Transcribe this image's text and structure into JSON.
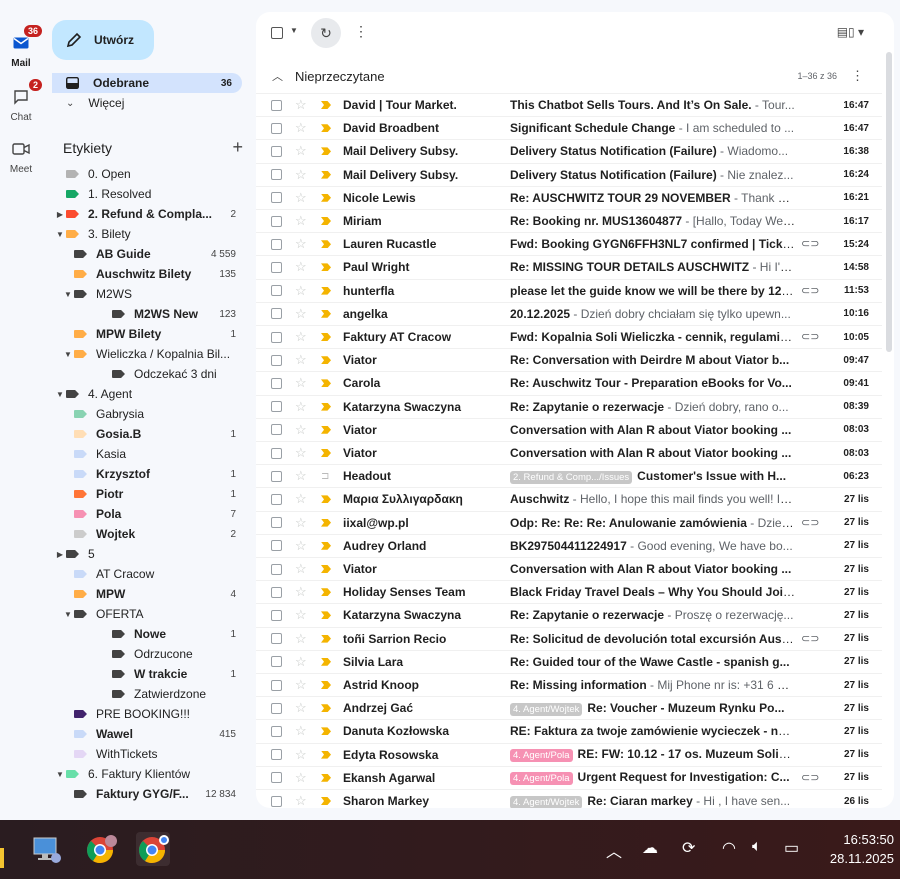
{
  "rail": [
    {
      "label": "Mail",
      "badge": "36",
      "active": true
    },
    {
      "label": "Chat",
      "badge": "2",
      "active": false
    },
    {
      "label": "Meet",
      "badge": null,
      "active": false
    }
  ],
  "sidebar": {
    "compose_label": "Utwórz",
    "nav": [
      {
        "label": "Odebrane",
        "count": "36"
      },
      {
        "label": "Więcej",
        "count": ""
      }
    ],
    "labels_title": "Etykiety",
    "labels": [
      {
        "name": "0. Open",
        "color": "#b3b3b3",
        "arrow": "",
        "indent": 0,
        "bold": false,
        "count": ""
      },
      {
        "name": "1. Resolved",
        "color": "#16a765",
        "arrow": "",
        "indent": 0,
        "bold": false,
        "count": ""
      },
      {
        "name": "2. Refund & Compla...",
        "color": "#fb4c2f",
        "arrow": "▶",
        "indent": 0,
        "bold": true,
        "count": "2"
      },
      {
        "name": "3. Bilety",
        "color": "#ffad47",
        "arrow": "▼",
        "indent": 0,
        "bold": false,
        "count": ""
      },
      {
        "name": "AB Guide",
        "color": "#434343",
        "arrow": "",
        "indent": 1,
        "bold": true,
        "count": "4 559"
      },
      {
        "name": "Auschwitz Bilety",
        "color": "#ffad47",
        "arrow": "",
        "indent": 1,
        "bold": true,
        "count": "135"
      },
      {
        "name": "M2WS",
        "color": "#434343",
        "arrow": "▼",
        "indent": 1,
        "bold": false,
        "count": ""
      },
      {
        "name": "M2WS New",
        "color": "#434343",
        "arrow": "",
        "indent": 2,
        "bold": true,
        "count": "123"
      },
      {
        "name": "MPW Bilety",
        "color": "#ffad47",
        "arrow": "",
        "indent": 1,
        "bold": true,
        "count": "1"
      },
      {
        "name": "Wieliczka / Kopalnia Bil...",
        "color": "#ffad47",
        "arrow": "▼",
        "indent": 1,
        "bold": false,
        "count": ""
      },
      {
        "name": "Odczekać 3 dni",
        "color": "#434343",
        "arrow": "",
        "indent": 2,
        "bold": false,
        "count": ""
      },
      {
        "name": "4. Agent",
        "color": "#434343",
        "arrow": "▼",
        "indent": 0,
        "bold": false,
        "count": ""
      },
      {
        "name": "Gabrysia",
        "color": "#89d3b2",
        "arrow": "",
        "indent": 1,
        "bold": false,
        "count": ""
      },
      {
        "name": "Gosia.B",
        "color": "#ffdeb5",
        "arrow": "",
        "indent": 1,
        "bold": true,
        "count": "1"
      },
      {
        "name": "Kasia",
        "color": "#c9daf8",
        "arrow": "",
        "indent": 1,
        "bold": false,
        "count": ""
      },
      {
        "name": "Krzysztof",
        "color": "#c9daf8",
        "arrow": "",
        "indent": 1,
        "bold": true,
        "count": "1"
      },
      {
        "name": "Piotr",
        "color": "#ff7537",
        "arrow": "",
        "indent": 1,
        "bold": true,
        "count": "1"
      },
      {
        "name": "Pola",
        "color": "#f691b3",
        "arrow": "",
        "indent": 1,
        "bold": true,
        "count": "7"
      },
      {
        "name": "Wojtek",
        "color": "#cccccc",
        "arrow": "",
        "indent": 1,
        "bold": true,
        "count": "2"
      },
      {
        "name": "5",
        "color": "#434343",
        "arrow": "▶",
        "indent": 0,
        "bold": false,
        "count": ""
      },
      {
        "name": "AT Cracow",
        "color": "#c9daf8",
        "arrow": "",
        "indent": 1,
        "bold": false,
        "count": ""
      },
      {
        "name": "MPW",
        "color": "#ffad47",
        "arrow": "",
        "indent": 1,
        "bold": true,
        "count": "4"
      },
      {
        "name": "OFERTA",
        "color": "#434343",
        "arrow": "▼",
        "indent": 1,
        "bold": false,
        "count": ""
      },
      {
        "name": "Nowe",
        "color": "#434343",
        "arrow": "",
        "indent": 2,
        "bold": true,
        "count": "1"
      },
      {
        "name": "Odrzucone",
        "color": "#434343",
        "arrow": "",
        "indent": 2,
        "bold": false,
        "count": ""
      },
      {
        "name": "W trakcie",
        "color": "#434343",
        "arrow": "",
        "indent": 2,
        "bold": true,
        "count": "1"
      },
      {
        "name": "Zatwierdzone",
        "color": "#434343",
        "arrow": "",
        "indent": 2,
        "bold": false,
        "count": ""
      },
      {
        "name": "PRE BOOKING!!!",
        "color": "#41236d",
        "arrow": "",
        "indent": 1,
        "bold": false,
        "count": ""
      },
      {
        "name": "Wawel",
        "color": "#c9daf8",
        "arrow": "",
        "indent": 1,
        "bold": true,
        "count": "415"
      },
      {
        "name": "WithTickets",
        "color": "#e4d7f5",
        "arrow": "",
        "indent": 1,
        "bold": false,
        "count": ""
      },
      {
        "name": "6. Faktury Klientów",
        "color": "#68dfa9",
        "arrow": "▼",
        "indent": 0,
        "bold": false,
        "count": ""
      },
      {
        "name": "Faktury GYG/F...",
        "color": "#434343",
        "arrow": "",
        "indent": 1,
        "bold": true,
        "count": "12 834"
      }
    ]
  },
  "section": {
    "title": "Nieprzeczytane",
    "range": "1–36 z 36"
  },
  "emails": [
    {
      "sender": "David | Tour Market.",
      "chip": "",
      "chip_color": "",
      "subject": "This Chatbot Sells Tours. And It’s On Sale.",
      "snippet": " - Tour...",
      "attach": false,
      "important": true,
      "time": "16:47"
    },
    {
      "sender": "David Broadbent",
      "chip": "",
      "chip_color": "",
      "subject": "Significant Schedule Change",
      "snippet": " - I am scheduled to ...",
      "attach": false,
      "important": true,
      "time": "16:47"
    },
    {
      "sender": "Mail Delivery Subsy.",
      "chip": "",
      "chip_color": "",
      "subject": "Delivery Status Notification (Failure)",
      "snippet": " - Wiadomo...",
      "attach": false,
      "important": true,
      "time": "16:38"
    },
    {
      "sender": "Mail Delivery Subsy.",
      "chip": "",
      "chip_color": "",
      "subject": "Delivery Status Notification (Failure)",
      "snippet": " - Nie znalez...",
      "attach": false,
      "important": true,
      "time": "16:24"
    },
    {
      "sender": "Nicole Lewis",
      "chip": "",
      "chip_color": "",
      "subject": "Re: AUSCHWITZ TOUR 29 NOVEMBER",
      "snippet": " - Thank yo...",
      "attach": false,
      "important": true,
      "time": "16:21"
    },
    {
      "sender": "Miriam",
      "chip": "",
      "chip_color": "",
      "subject": "Re: Booking nr. MUS13604877",
      "snippet": " - [Hallo, Today We ...",
      "attach": false,
      "important": true,
      "time": "16:17"
    },
    {
      "sender": "Lauren Rucastle",
      "chip": "",
      "chip_color": "",
      "subject": "Fwd: Booking GYGN6FFH3NL7 confirmed | Ticke...",
      "snippet": "",
      "attach": true,
      "important": true,
      "time": "15:24"
    },
    {
      "sender": "Paul Wright",
      "chip": "",
      "chip_color": "",
      "subject": "Re: MISSING TOUR DETAILS AUSCHWITZ",
      "snippet": " - Hi I'v...",
      "attach": false,
      "important": true,
      "time": "14:58"
    },
    {
      "sender": "hunterfla",
      "chip": "",
      "chip_color": "",
      "subject": "please let the guide know we will be there by 12:...",
      "snippet": "",
      "attach": true,
      "important": true,
      "time": "11:53"
    },
    {
      "sender": "angelka",
      "chip": "",
      "chip_color": "",
      "subject": "20.12.2025",
      "snippet": " - Dzień dobry chciałam się tylko upewn...",
      "attach": false,
      "important": true,
      "time": "10:16"
    },
    {
      "sender": "Faktury AT Cracow",
      "chip": "",
      "chip_color": "",
      "subject": "Fwd: Kopalnia Soli Wieliczka - cennik, regulamin...",
      "snippet": "",
      "attach": true,
      "important": true,
      "time": "10:05"
    },
    {
      "sender": "Viator",
      "chip": "",
      "chip_color": "",
      "subject": "Re: Conversation with Deirdre M about Viator b...",
      "snippet": "",
      "attach": false,
      "important": true,
      "time": "09:47"
    },
    {
      "sender": "Carola",
      "chip": "",
      "chip_color": "",
      "subject": "Re: Auschwitz Tour - Preparation eBooks for Vo...",
      "snippet": "",
      "attach": false,
      "important": true,
      "time": "09:41"
    },
    {
      "sender": "Katarzyna Swaczyna",
      "chip": "",
      "chip_color": "",
      "subject": "Re: Zapytanie o rezerwacje",
      "snippet": " - Dzień dobry, rano o...",
      "attach": false,
      "important": true,
      "time": "08:39"
    },
    {
      "sender": "Viator",
      "chip": "",
      "chip_color": "",
      "subject": "Conversation with Alan R about Viator booking ...",
      "snippet": "",
      "attach": false,
      "important": true,
      "time": "08:03"
    },
    {
      "sender": "Viator",
      "chip": "",
      "chip_color": "",
      "subject": "Conversation with Alan R about Viator booking ...",
      "snippet": "",
      "attach": false,
      "important": true,
      "time": "08:03"
    },
    {
      "sender": "Headout",
      "chip": "2. Refund & Comp.../Issues",
      "chip_color": "#c7c7c7",
      "subject": "Customer's Issue with H...",
      "snippet": "",
      "attach": false,
      "important": false,
      "time": "06:23"
    },
    {
      "sender": "Μαρια Συλλιγαρδακη",
      "chip": "",
      "chip_color": "",
      "subject": "Auschwitz",
      "snippet": " - Hello, I hope this mail finds you well! I j...",
      "attach": false,
      "important": true,
      "time": "27 lis"
    },
    {
      "sender": "iixal@wp.pl",
      "chip": "",
      "chip_color": "",
      "subject": "Odp: Re: Re: Re: Anulowanie zamówienia",
      "snippet": " - Dzień...",
      "attach": true,
      "important": true,
      "time": "27 lis"
    },
    {
      "sender": "Audrey Orland",
      "chip": "",
      "chip_color": "",
      "subject": "BK297504411224917",
      "snippet": " - Good evening, We have bo...",
      "attach": false,
      "important": true,
      "time": "27 lis"
    },
    {
      "sender": "Viator",
      "chip": "",
      "chip_color": "",
      "subject": "Conversation with Alan R about Viator booking ...",
      "snippet": "",
      "attach": false,
      "important": true,
      "time": "27 lis"
    },
    {
      "sender": "Holiday Senses Team",
      "chip": "",
      "chip_color": "",
      "subject": "Black Friday Travel Deals – Why You Should Join",
      "snippet": " -",
      "attach": false,
      "important": true,
      "time": "27 lis"
    },
    {
      "sender": "Katarzyna Swaczyna",
      "chip": "",
      "chip_color": "",
      "subject": "Re: Zapytanie o rezerwacje",
      "snippet": " - Proszę o rezerwację...",
      "attach": false,
      "important": true,
      "time": "27 lis"
    },
    {
      "sender": "toñi Sarrion Recio",
      "chip": "",
      "chip_color": "",
      "subject": "Re: Solicitud de devolución total excursión Ausc...",
      "snippet": "",
      "attach": true,
      "important": true,
      "time": "27 lis"
    },
    {
      "sender": "Silvia Lara",
      "chip": "",
      "chip_color": "",
      "subject": "Re: Guided tour of the Wawe Castle - spanish g...",
      "snippet": "",
      "attach": false,
      "important": true,
      "time": "27 lis"
    },
    {
      "sender": "Astrid Knoop",
      "chip": "",
      "chip_color": "",
      "subject": "Re: Missing information",
      "snippet": " - Mij Phone nr is: +31 6 55...",
      "attach": false,
      "important": true,
      "time": "27 lis"
    },
    {
      "sender": "Andrzej Gać",
      "chip": "4. Agent/Wojtek",
      "chip_color": "#c7c7c7",
      "subject": "Re: Voucher - Muzeum Rynku Po...",
      "snippet": "",
      "attach": false,
      "important": true,
      "time": "27 lis"
    },
    {
      "sender": "Danuta Kozłowska",
      "chip": "",
      "chip_color": "",
      "subject": "RE: Faktura za twoje zamówienie wycieczek - nu...",
      "snippet": "",
      "attach": false,
      "important": true,
      "time": "27 lis"
    },
    {
      "sender": "Edyta Rosowska",
      "chip": "4. Agent/Pola",
      "chip_color": "#f691b3",
      "subject": "RE: FW: 10.12 - 17 os. Muzeum Solid...",
      "snippet": "",
      "attach": false,
      "important": true,
      "time": "27 lis"
    },
    {
      "sender": "Ekansh Agarwal",
      "chip": "4. Agent/Pola",
      "chip_color": "#f691b3",
      "subject": "Urgent Request for Investigation: C...",
      "snippet": "",
      "attach": true,
      "important": true,
      "time": "27 lis"
    },
    {
      "sender": "Sharon Markey",
      "chip": "4. Agent/Wojtek",
      "chip_color": "#c7c7c7",
      "subject": "Re: Ciaran markey",
      "snippet": " - Hi , I have sen...",
      "attach": false,
      "important": true,
      "time": "26 lis"
    }
  ],
  "clock": {
    "time": "16:53:50",
    "date": "28.11.2025"
  }
}
